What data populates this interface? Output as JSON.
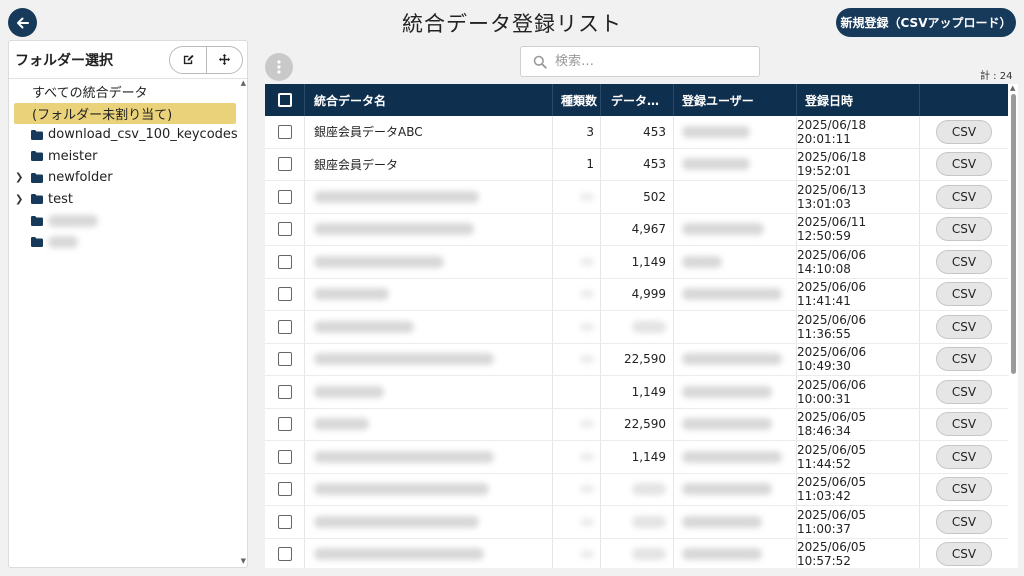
{
  "header": {
    "title": "統合データ登録リスト",
    "upload_button": "新規登録（CSVアップロード）"
  },
  "sidebar": {
    "title": "フォルダー選択",
    "items": [
      {
        "label": "すべての統合データ",
        "type": "root"
      },
      {
        "label": "(フォルダー未割り当て)",
        "type": "selected"
      },
      {
        "label": "download_csv_100_keycodes",
        "type": "folder"
      },
      {
        "label": "meister",
        "type": "folder"
      },
      {
        "label": "newfolder",
        "type": "folder-expandable"
      },
      {
        "label": "test",
        "type": "folder-expandable"
      },
      {
        "label": "",
        "type": "folder-blurred"
      },
      {
        "label": "",
        "type": "folder-blurred"
      }
    ]
  },
  "search": {
    "placeholder": "検索…"
  },
  "count_label": "計 : 24",
  "table": {
    "headers": {
      "name": "統合データ名",
      "types": "種類数",
      "data": "データ…",
      "user": "登録ユーザー",
      "date": "登録日時"
    },
    "csv_label": "CSV",
    "rows": [
      {
        "name": "銀座会員データABC",
        "types": "3",
        "data": "453",
        "date": "2025/06/18 20:01:11"
      },
      {
        "name": "銀座会員データ",
        "types": "1",
        "data": "453",
        "date": "2025/06/18 19:52:01"
      },
      {
        "name": "",
        "types": "",
        "data": "502",
        "date": "2025/06/13 13:01:03"
      },
      {
        "name": "",
        "types": "",
        "data": "4,967",
        "date": "2025/06/11 12:50:59"
      },
      {
        "name": "",
        "types": "",
        "data": "1,149",
        "date": "2025/06/06 14:10:08"
      },
      {
        "name": "",
        "types": "",
        "data": "4,999",
        "date": "2025/06/06 11:41:41"
      },
      {
        "name": "",
        "types": "",
        "data": "",
        "date": "2025/06/06 11:36:55"
      },
      {
        "name": "",
        "types": "",
        "data": "22,590",
        "date": "2025/06/06 10:49:30"
      },
      {
        "name": "",
        "types": "",
        "data": "1,149",
        "date": "2025/06/06 10:00:31"
      },
      {
        "name": "",
        "types": "",
        "data": "22,590",
        "date": "2025/06/05 18:46:34"
      },
      {
        "name": "",
        "types": "",
        "data": "1,149",
        "date": "2025/06/05 11:44:52"
      },
      {
        "name": "",
        "types": "",
        "data": "",
        "date": "2025/06/05 11:03:42"
      },
      {
        "name": "",
        "types": "",
        "data": "",
        "date": "2025/06/05 11:00:37"
      },
      {
        "name": "",
        "types": "",
        "data": "",
        "date": "2025/06/05 10:57:52"
      }
    ]
  },
  "colors": {
    "primary": "#173a5a",
    "header_bg": "#0f2f4f",
    "selected_folder": "#ead27a"
  }
}
